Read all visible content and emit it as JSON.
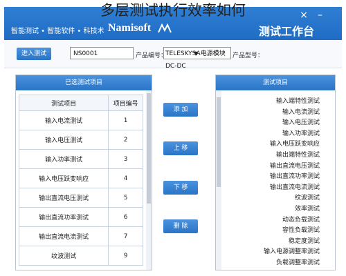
{
  "overlay_title": "多层测试执行效率如何",
  "titlebar": {
    "controls": [
      "×",
      "–"
    ],
    "left_text": "智能测试 • 智能软件 • 科技术",
    "brand": "Namisoft",
    "right_text": "测试工作台"
  },
  "toolbar": {
    "enter_button": "进入测试",
    "product_model_label": "产品型号：",
    "product_model_value": "TELESKYSA电源模块DC-DC",
    "product_no_label": "产品编号：",
    "product_no_value": "NS0001"
  },
  "left_panel": {
    "header": "已选测试项目",
    "columns": [
      "测试项目",
      "项目编号"
    ],
    "rows": [
      {
        "name": "输入电流测试",
        "no": "1"
      },
      {
        "name": "输入电压测试",
        "no": "2"
      },
      {
        "name": "输入功率测试",
        "no": "3"
      },
      {
        "name": "输入电压跃变响应",
        "no": "4"
      },
      {
        "name": "输出直流电压测试",
        "no": "5"
      },
      {
        "name": "输出直流功率测试",
        "no": "6"
      },
      {
        "name": "输出直流电流测试",
        "no": "7"
      },
      {
        "name": "纹波测试",
        "no": "9"
      }
    ]
  },
  "middle_buttons": {
    "add": "添 加",
    "up": "上 移",
    "down": "下 移",
    "delete": "删 除"
  },
  "right_panel": {
    "header": "测试项目",
    "items": [
      "输入端特性测试",
      "输入电流测试",
      "输入电压测试",
      "输入功率测试",
      "输入电压跃变响应",
      "输出端特性测试",
      "输出直流电压测试",
      "输出直流功率测试",
      "输出直流电流测试",
      "纹波测试",
      "效率测试",
      "动态负载测试",
      "容性负载测试",
      "稳定度测试",
      "输入电源调整率测试",
      "负载调整率测试"
    ]
  }
}
